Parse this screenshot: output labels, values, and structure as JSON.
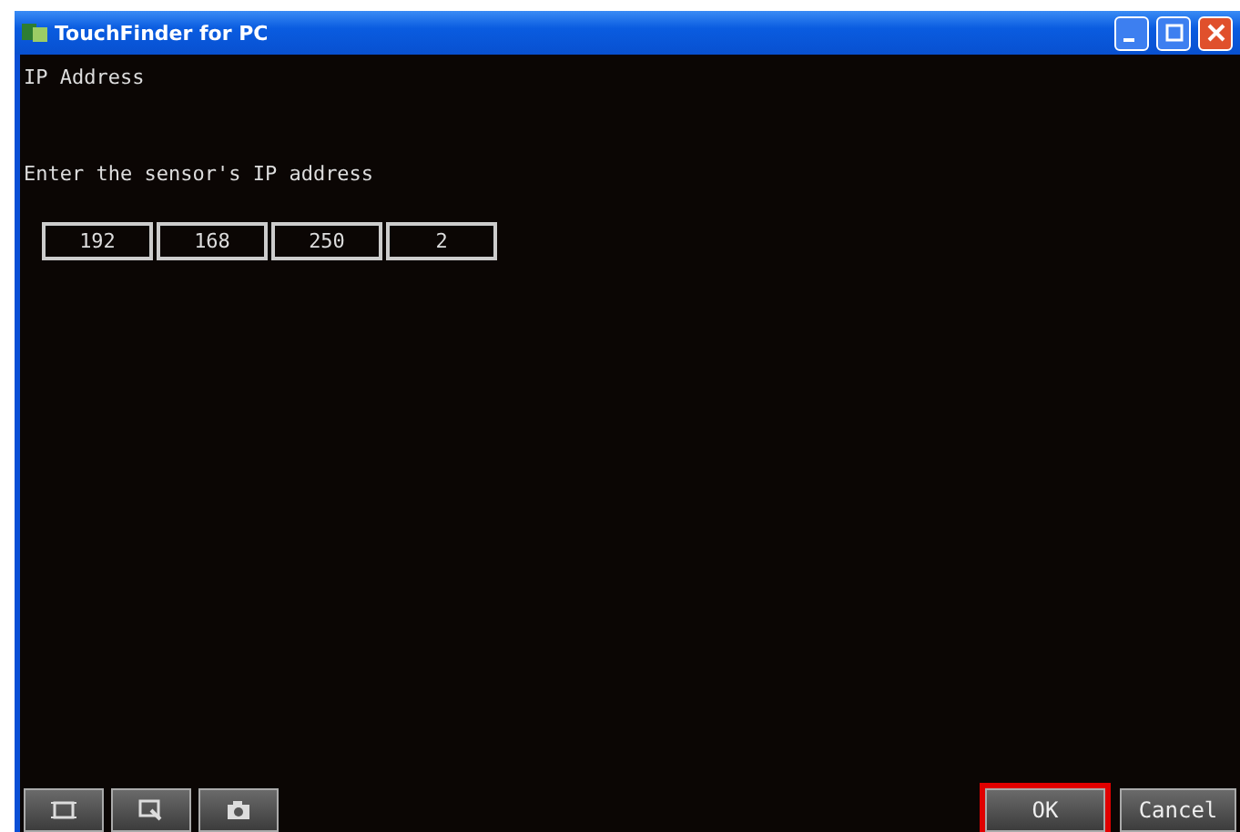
{
  "window": {
    "title": "TouchFinder for PC"
  },
  "heading": "IP Address",
  "prompt": "Enter the sensor's IP address",
  "ip_fields": [
    "192",
    "168",
    "250",
    "2"
  ],
  "tool_buttons": [
    {
      "kind": "frame"
    },
    {
      "kind": "zoom"
    },
    {
      "kind": "camera"
    }
  ],
  "buttons": [
    {
      "label": "OK",
      "highlighted": true
    },
    {
      "label": "Cancel",
      "highlighted": false
    }
  ]
}
